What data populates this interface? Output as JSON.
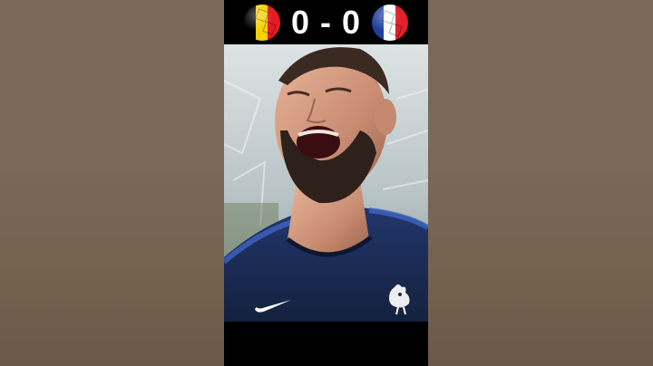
{
  "match": {
    "home_team": "Belgium",
    "away_team": "France",
    "home_score": "0",
    "separator": "-",
    "away_score": "0",
    "home_flag_colors": [
      "#000000",
      "#f5d100",
      "#e31b23"
    ],
    "away_flag_colors": [
      "#1f3d99",
      "#ffffff",
      "#e0202b"
    ]
  },
  "icons": {
    "home_flag": "belgium-flag-ball-icon",
    "away_flag": "france-flag-ball-icon",
    "kit_brand": "nike-swoosh-icon",
    "crest": "rooster-crest-icon"
  },
  "colors": {
    "jersey": "#1a2a52",
    "background": "#000000"
  }
}
